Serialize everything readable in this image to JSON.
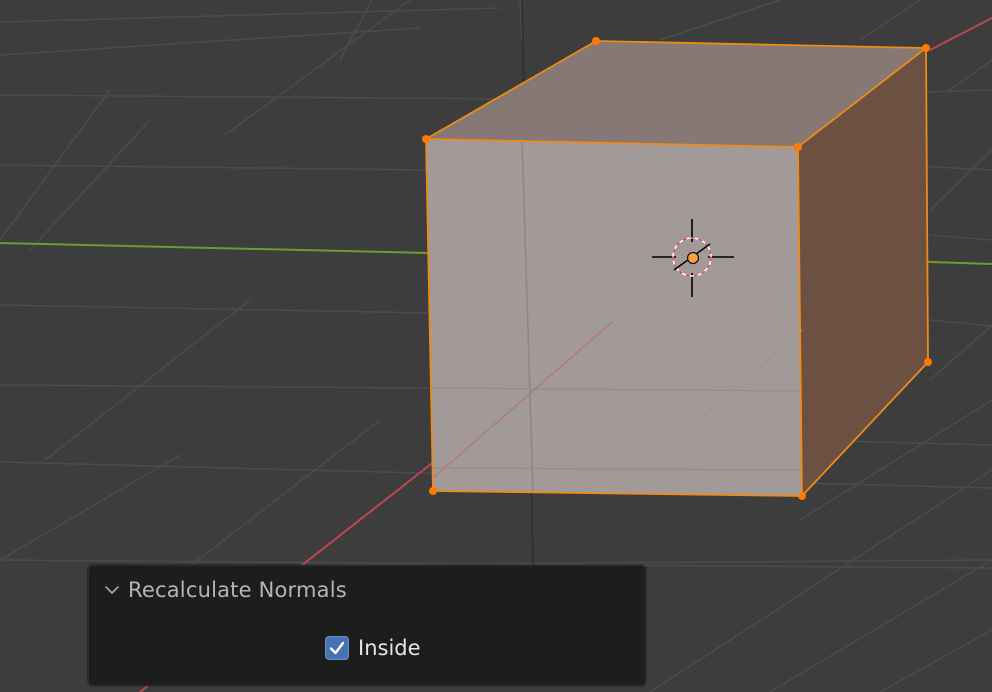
{
  "viewport": {
    "name": "3D Viewport",
    "object": "Cube",
    "colors": {
      "background": "#3d3d3d",
      "grid": "#4c4c4c",
      "x_axis": "#c0474f",
      "y_axis": "#6f9a2c",
      "selection": "#f08a16",
      "vertex": "#ff7a00",
      "face_front": "#a59d9b",
      "face_top": "#887a76",
      "face_side": "#6d5142"
    }
  },
  "operator_panel": {
    "title": "Recalculate Normals",
    "collapse_icon": "chevron-down-icon",
    "options": [
      {
        "label": "Inside",
        "checked": true
      }
    ]
  }
}
